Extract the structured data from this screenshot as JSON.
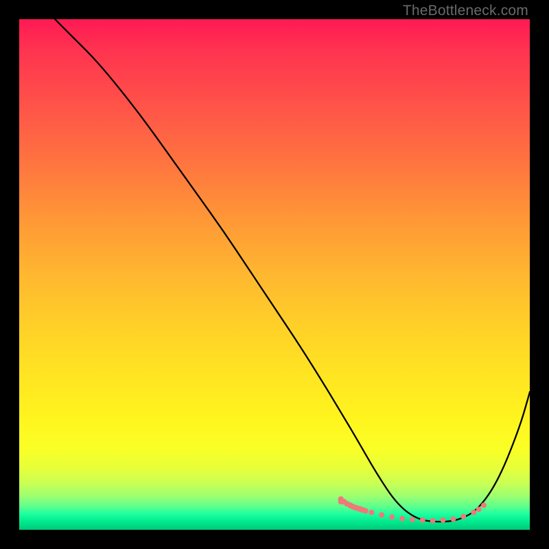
{
  "watermark": {
    "text": "TheBottleneck.com"
  },
  "chart_data": {
    "type": "line",
    "title": "",
    "xlabel": "",
    "ylabel": "",
    "xlim": [
      0,
      100
    ],
    "ylim": [
      0,
      100
    ],
    "grid": false,
    "legend": false,
    "series": [
      {
        "name": "curve",
        "x": [
          7,
          10,
          15,
          20,
          25,
          30,
          35,
          40,
          45,
          50,
          55,
          60,
          63,
          66,
          70,
          74,
          78,
          82,
          86,
          90,
          94,
          98,
          100
        ],
        "y": [
          100,
          97,
          92,
          86,
          79.5,
          72.5,
          65.5,
          58.5,
          51,
          43.5,
          36,
          28,
          23,
          18,
          11,
          5,
          2,
          1.5,
          1.8,
          4,
          10,
          20,
          27
        ]
      }
    ],
    "markers": [
      {
        "name": "highlight-dots",
        "color": "#ef7878",
        "x": [
          63,
          65,
          67,
          69,
          71,
          73,
          75,
          77,
          79,
          81,
          83,
          85,
          87,
          89,
          90,
          91
        ],
        "y": [
          5.5,
          4.7,
          4.0,
          3.4,
          2.9,
          2.5,
          2.2,
          2.0,
          1.9,
          1.8,
          1.9,
          2.1,
          2.6,
          3.4,
          4.0,
          4.8
        ]
      },
      {
        "name": "highlight-dense-dots",
        "color": "#ef7878",
        "x": [
          63,
          63.6,
          64.2,
          64.8,
          65.4,
          66,
          66.6,
          67.2,
          67.8
        ],
        "y": [
          6.0,
          5.5,
          5.1,
          4.8,
          4.5,
          4.3,
          4.1,
          3.9,
          3.7
        ]
      }
    ],
    "background_gradient_stops": [
      {
        "pos": 0,
        "color": "#ff1a54"
      },
      {
        "pos": 0.5,
        "color": "#ffb730"
      },
      {
        "pos": 0.8,
        "color": "#fff41e"
      },
      {
        "pos": 0.95,
        "color": "#5bff8e"
      },
      {
        "pos": 1.0,
        "color": "#00c97c"
      }
    ]
  }
}
